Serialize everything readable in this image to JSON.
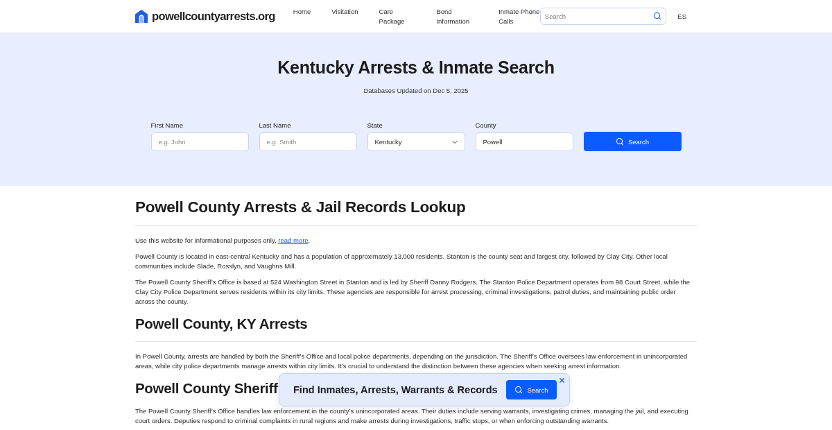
{
  "header": {
    "logo": "powellcountyarrests.org",
    "nav": [
      "Home",
      "Visitation",
      "Care Package",
      "Bond Information",
      "Inmate Phone Calls"
    ],
    "search": {
      "placeholder": "Search"
    },
    "language": "ES"
  },
  "hero": {
    "title": "Kentucky Arrests & Inmate Search",
    "subtitle": "Databases Updated on Dec 5, 2025",
    "fields": [
      {
        "kind": "text",
        "label": "First Name",
        "placeholder": "e.g. John"
      },
      {
        "kind": "text",
        "label": "Last Name",
        "placeholder": "e.g. Smith"
      },
      {
        "kind": "select",
        "label": "State",
        "value": "Kentucky"
      },
      {
        "kind": "text",
        "label": "County",
        "value": "Powell"
      }
    ],
    "button": "Search"
  },
  "sections": [
    {
      "kind": "title",
      "heading": "Powell County Arrests & Jail Records Lookup",
      "divider": true,
      "paragraphs": [
        {
          "text": "Use this website for informational purposes only,",
          "link": "read more",
          "tail": "."
        },
        {
          "text": "Powell County is located in east-central Kentucky and has a population of approximately 13,000 residents. Stanton is the county seat and largest city, followed by Clay City. Other local communities include Slade, Rosslyn, and Vaughns Mill."
        },
        {
          "text": "The Powell County Sheriff’s Office is based at 524 Washington Street in Stanton and is led by Sheriff Danny Rodgers. The Stanton Police Department operates from 98 Court Street, while the Clay City Police Department serves residents within its city limits. These agencies are responsible for arrest processing, criminal investigations, patrol duties, and maintaining public order across the county."
        }
      ]
    },
    {
      "kind": "section",
      "heading": "Powell County, KY Arrests",
      "divider": true,
      "paragraphs": [
        {
          "text": "In Powell County, arrests are handled by both the Sheriff’s Office and local police departments, depending on the jurisdiction. The Sheriff’s Office oversees law enforcement in unincorporated areas, while city police departments manage arrests within city limits. It’s crucial to understand the distinction between these agencies when seeking arrest information."
        }
      ]
    },
    {
      "kind": "section",
      "heading": "Powell County Sheriff",
      "divider": false,
      "paragraphs": [
        {
          "text": "The Powell County Sheriff’s Office handles law enforcement in the county’s unincorporated areas. Their duties include serving warrants, investigating crimes, managing the jail, and executing court orders. Deputies respond to criminal complaints in rural regions and make arrests during investigations, traffic stops, or when enforcing outstanding warrants."
        }
      ]
    }
  ],
  "popup": {
    "title": "Find Inmates, Arrests, Warrants & Records",
    "button": "Search"
  }
}
